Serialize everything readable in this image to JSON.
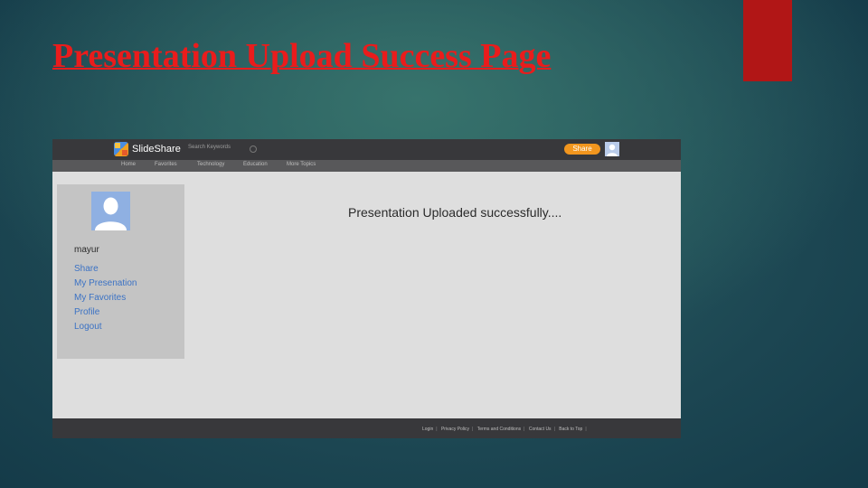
{
  "slide": {
    "title": "Presentation Upload Success Page",
    "accent_color": "#b11616",
    "title_color": "#ea1c1c"
  },
  "app": {
    "brand": "SlideShare",
    "search_placeholder": "Search Keywords",
    "share_button": "Share",
    "nav": [
      "Home",
      "Favorites",
      "Technology",
      "Education",
      "More Topics"
    ],
    "sidebar": {
      "username": "mayur",
      "links": [
        "Share",
        "My Presenation",
        "My Favorites",
        "Profile",
        "Logout"
      ]
    },
    "message": "Presentation Uploaded successfully....",
    "footer": [
      "Login",
      "Privacy Policy",
      "Terms and Conditions",
      "Contact Us",
      "Back to Top"
    ]
  }
}
